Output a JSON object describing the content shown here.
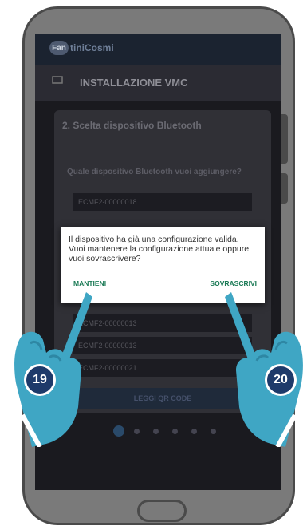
{
  "app": {
    "logo_prefix": "Fan",
    "logo_text": "tiniCosmi",
    "install_icon_label": "VMC",
    "install_title": "INSTALLAZIONE VMC"
  },
  "card": {
    "step_title": "2. Scelta dispositivo Bluetooth",
    "question": "Quale dispositivo Bluetooth vuoi aggiungere?",
    "devices": [
      "ECMF2-00000018",
      "ECMF2-00000013",
      "ECMF2-00000013",
      "ECMF2-00000021"
    ],
    "qr_button": "LEGGI QR CODE"
  },
  "dialog": {
    "message": "Il dispositivo ha già una configurazione valida. Vuoi mantenere la configurazione attuale oppure vuoi sovrascrivere?",
    "keep_label": "MANTIENI",
    "overwrite_label": "SOVRASCRIVI"
  },
  "steps": {
    "left": "19",
    "right": "20"
  },
  "colors": {
    "accent": "#1a7a55",
    "badge": "#1e3a6a",
    "hand": "#3fa6c4"
  }
}
